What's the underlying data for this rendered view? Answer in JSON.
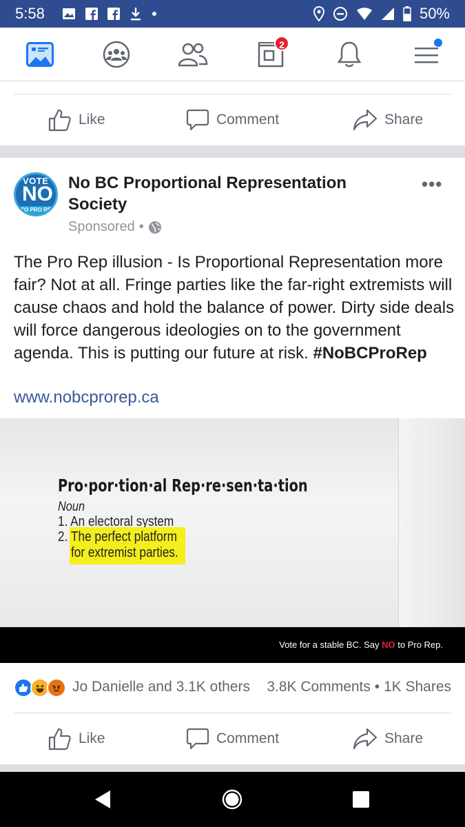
{
  "status_bar": {
    "time": "5:58",
    "battery": "50%"
  },
  "nav": {
    "items": [
      {
        "name": "news-feed"
      },
      {
        "name": "groups"
      },
      {
        "name": "friends"
      },
      {
        "name": "marketplace",
        "badge": "2"
      },
      {
        "name": "notifications"
      },
      {
        "name": "menu"
      }
    ]
  },
  "actions": {
    "like": "Like",
    "comment": "Comment",
    "share": "Share"
  },
  "post": {
    "page_name": "No BC Proportional Representation Society",
    "sponsored": "Sponsored",
    "meta_sep": "•",
    "more": "•••",
    "avatar": {
      "top": "VOTE",
      "main": "NO",
      "bottom": "TO PRO REP"
    },
    "body": "The Pro Rep illusion - Is Proportional Representation more fair? Not at all. Fringe parties like the far-right extremists will cause chaos and hold the balance of power. Dirty side deals will force dangerous ideologies on to the government agenda. This is putting our future at risk.",
    "hashtag": "#NoBCProRep",
    "link": "www.nobcprorep.ca"
  },
  "media": {
    "definition_title": "Pro·por·tion·al Rep·re·sen·ta·tion",
    "pos": "Noun",
    "def1": "1. An electoral system",
    "def2_num": "2.",
    "def2_line1": "The perfect platform",
    "def2_line2": "for extremist parties.",
    "tagline_pre": "Vote for a stable BC. Say",
    "tagline_no": "NO",
    "tagline_post": "to Pro Rep."
  },
  "reactions": {
    "names": "Jo Danielle and 3.1K others",
    "comments": "3.8K Comments",
    "sep": "•",
    "shares": "1K Shares"
  },
  "colors": {
    "status_bar": "#2e4c8f",
    "link": "#385898",
    "highlight": "#f5ee1d",
    "badge": "#e4212f"
  }
}
